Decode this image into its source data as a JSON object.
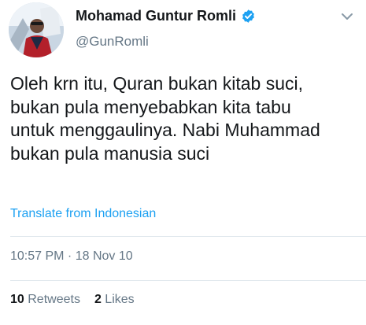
{
  "tweet": {
    "author": {
      "display_name": "Mohamad Guntur Romli",
      "handle": "@GunRomli",
      "verified": true
    },
    "text": "Oleh krn itu, Quran bukan kitab suci,\nbukan pula menyebabkan kita tabu\nuntuk menggaulinya. Nabi Muhammad\nbukan pula manusia suci",
    "translate_label": "Translate from Indonesian",
    "timestamp": "10:57 PM · 18 Nov 10",
    "stats": {
      "retweets_count": "10",
      "retweets_label": "Retweets",
      "likes_count": "2",
      "likes_label": "Likes"
    }
  },
  "colors": {
    "link": "#1da1f2",
    "muted": "#657786",
    "text": "#14171a",
    "divider": "#e1e8ed"
  },
  "icons": {
    "verified": "verified-badge-icon",
    "menu": "chevron-down-icon"
  }
}
